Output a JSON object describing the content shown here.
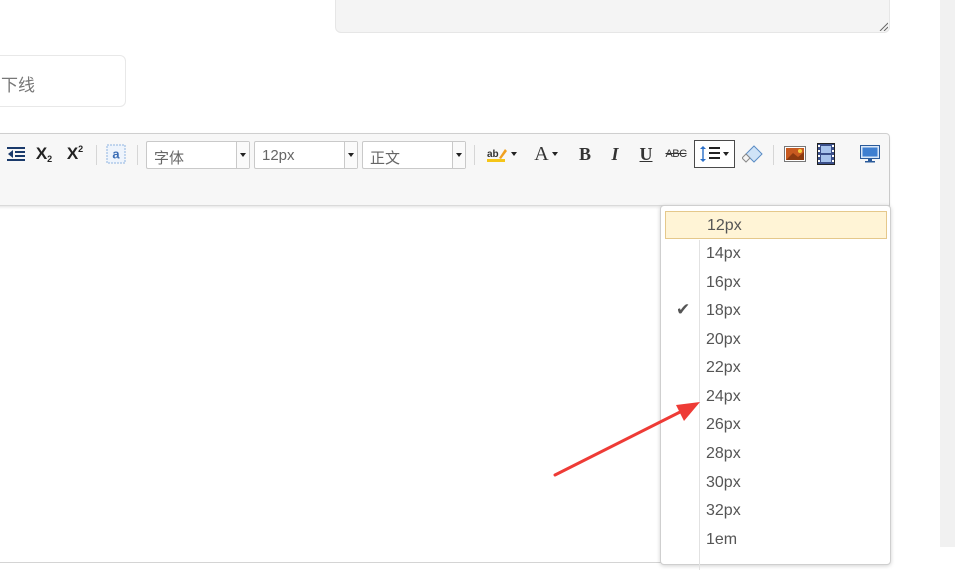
{
  "input": {
    "value": "下线"
  },
  "toolbar": {
    "font_family": "字体",
    "font_size": "12px",
    "paragraph": "正文",
    "bold": "B",
    "italic": "I",
    "underline": "U",
    "strike": "ABC",
    "font_color": "A",
    "subscript_main": "X",
    "subscript_sub": "2",
    "superscript_main": "X",
    "superscript_sup": "2",
    "icons": [
      "indent-icon",
      "subscript-icon",
      "superscript-icon",
      "auto-typeset-icon",
      "backcolor-icon",
      "forecolor-icon",
      "line-height-icon",
      "eraser-icon",
      "image-icon",
      "video-icon",
      "preview-icon"
    ]
  },
  "line_height_menu": {
    "selected": "18px",
    "hover": "12px",
    "check_mark": "✔",
    "items": [
      "12px",
      "14px",
      "16px",
      "18px",
      "20px",
      "22px",
      "24px",
      "26px",
      "28px",
      "30px",
      "32px",
      "1em"
    ]
  }
}
